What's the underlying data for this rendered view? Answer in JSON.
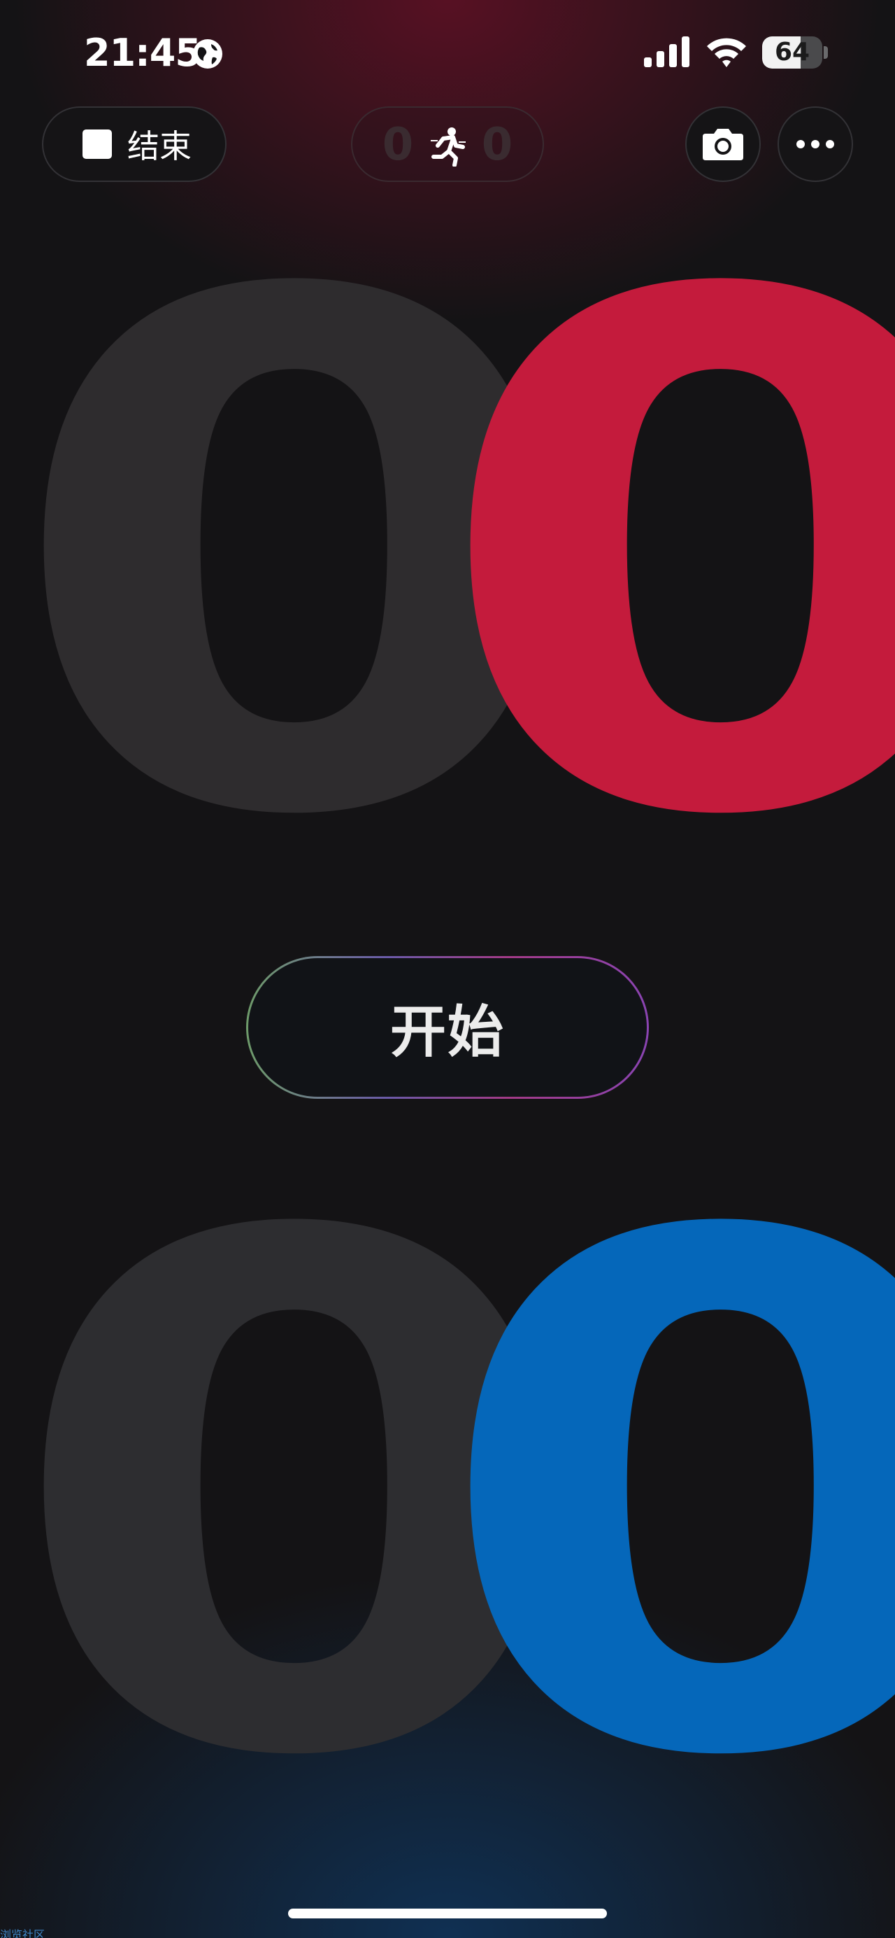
{
  "status_bar": {
    "time": "21:45",
    "battery_level": "64",
    "battery_fraction": 0.64
  },
  "top_bar": {
    "end_label": "结束",
    "mini_score_left": "0",
    "mini_score_right": "0"
  },
  "scoreboard": {
    "top_left_digit": "0",
    "top_right_digit": "0",
    "bottom_left_digit": "0",
    "bottom_right_digit": "0"
  },
  "start_label": "开始",
  "watermark": "浏览社区",
  "colors": {
    "background": "#141315",
    "red_team": "#c41b3c",
    "blue_team": "#0567ba",
    "inactive_digit": "#2e2c2e"
  },
  "icons": [
    "globe-icon",
    "signal-icon",
    "wifi-icon",
    "battery-icon",
    "stop-icon",
    "runner-icon",
    "camera-icon",
    "more-icon"
  ]
}
